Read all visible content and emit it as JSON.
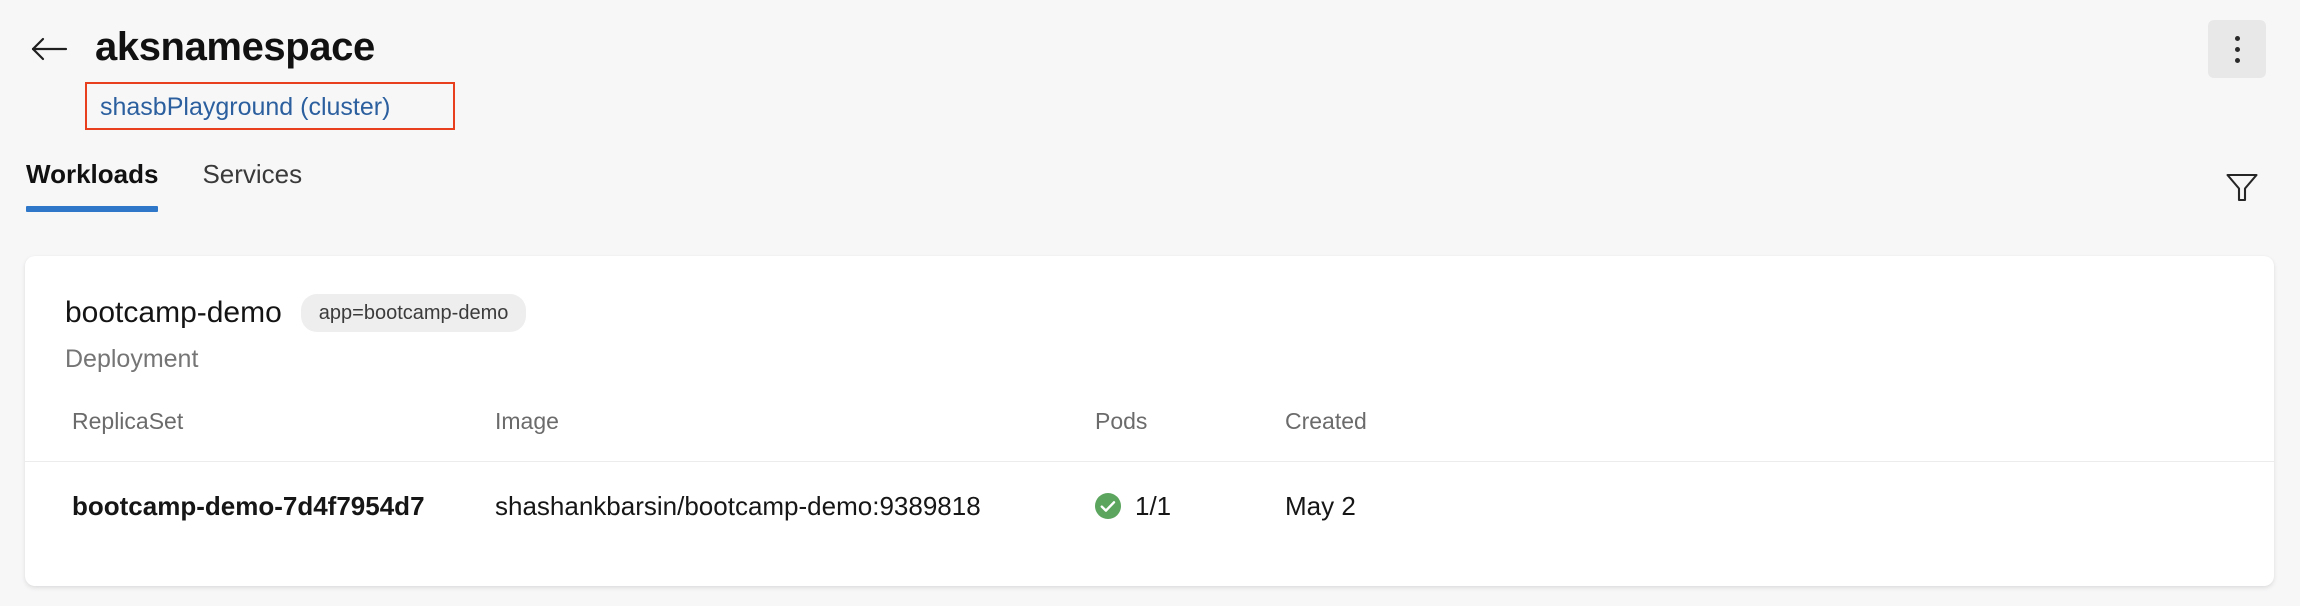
{
  "header": {
    "back_icon": "arrow-left-icon",
    "title": "aksnamespace",
    "cluster_link": "shasbPlayground (cluster)",
    "more_button_icon": "more-vertical-icon",
    "highlight_color": "#e8401f",
    "link_color": "#2b5f9e"
  },
  "tab_bar": {
    "tabs": [
      {
        "label": "Workloads",
        "active": true
      },
      {
        "label": "Services",
        "active": false
      }
    ],
    "filter_icon": "filter-funnel-icon",
    "active_indicator_color": "#2e77c9"
  },
  "workload_card": {
    "title": "bootcamp-demo",
    "label_pill": "app=bootcamp-demo",
    "kind": "Deployment",
    "table": {
      "columns": [
        "ReplicaSet",
        "Image",
        "Pods",
        "Created"
      ],
      "rows": [
        {
          "replicaset": "bootcamp-demo-7d4f7954d7",
          "image": "shashankbarsin/bootcamp-demo:9389818",
          "pods": "1/1",
          "pods_status_icon": "check-circle-icon",
          "pods_status_color": "#5ba55e",
          "created": "May 2"
        }
      ]
    }
  },
  "theme": {
    "page_background": "#f7f7f8",
    "card_background": "#ffffff"
  }
}
